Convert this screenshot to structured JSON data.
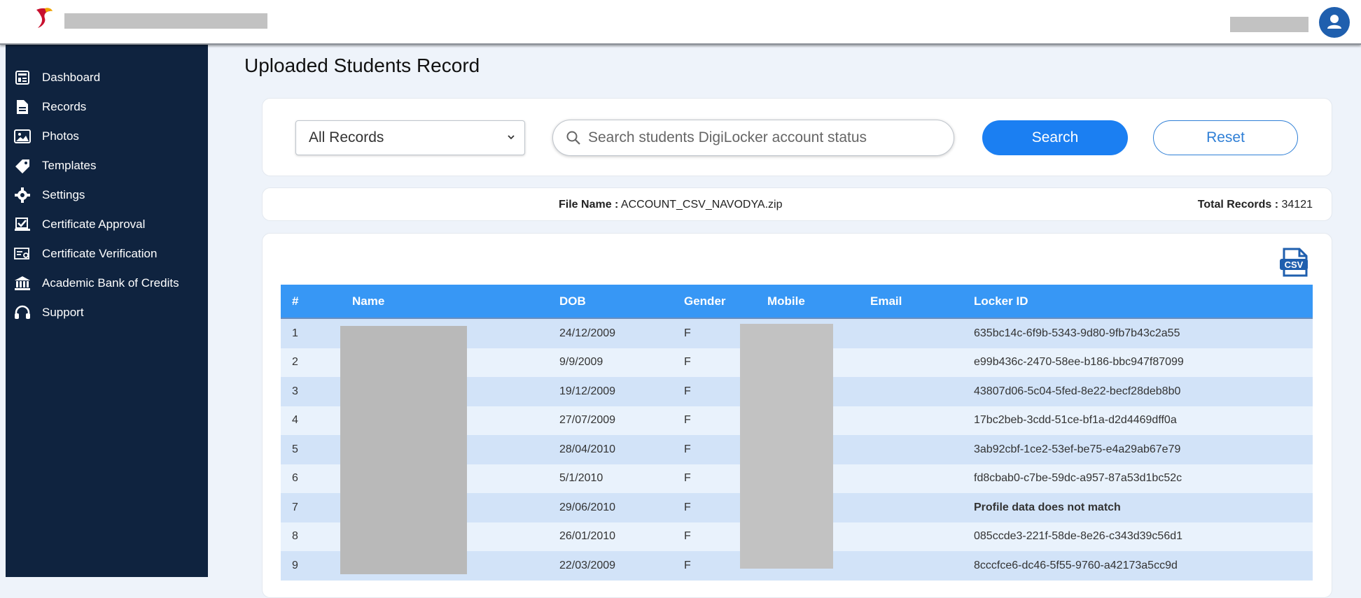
{
  "header": {
    "logo_icon": "logo-icon",
    "avatar_icon": "user-icon",
    "brand_color": "#1f5fae"
  },
  "sidebar": {
    "items": [
      {
        "label": "Dashboard",
        "icon": "dashboard-icon"
      },
      {
        "label": "Records",
        "icon": "file-icon"
      },
      {
        "label": "Photos",
        "icon": "photos-icon"
      },
      {
        "label": "Templates",
        "icon": "tag-icon"
      },
      {
        "label": "Settings",
        "icon": "gear-icon"
      },
      {
        "label": "Certificate Approval",
        "icon": "approval-icon"
      },
      {
        "label": "Certificate Verification",
        "icon": "verification-icon"
      },
      {
        "label": "Academic Bank of Credits",
        "icon": "bank-icon"
      },
      {
        "label": "Support",
        "icon": "headset-icon"
      }
    ]
  },
  "page": {
    "title": "Uploaded Students Record"
  },
  "filter": {
    "select_value": "All Records",
    "search_placeholder": "Search students DigiLocker account status",
    "search_button": "Search",
    "reset_button": "Reset"
  },
  "info": {
    "file_label": "File Name :",
    "file_value": "ACCOUNT_CSV_NAVODYA.zip",
    "total_label": "Total Records :",
    "total_value": "34121"
  },
  "table": {
    "csv_icon": "csv-download-icon",
    "columns": [
      "#",
      "Name",
      "DOB",
      "Gender",
      "Mobile",
      "Email",
      "Locker ID"
    ],
    "rows": [
      {
        "num": "1",
        "dob": "24/12/2009",
        "gender": "F",
        "locker": "635bc14c-6f9b-5343-9d80-9fb7b43c2a55"
      },
      {
        "num": "2",
        "dob": "9/9/2009",
        "gender": "F",
        "locker": "e99b436c-2470-58ee-b186-bbc947f87099"
      },
      {
        "num": "3",
        "dob": "19/12/2009",
        "gender": "F",
        "locker": "43807d06-5c04-5fed-8e22-becf28deb8b0"
      },
      {
        "num": "4",
        "dob": "27/07/2009",
        "gender": "F",
        "locker": "17bc2beb-3cdd-51ce-bf1a-d2d4469dff0a"
      },
      {
        "num": "5",
        "dob": "28/04/2010",
        "gender": "F",
        "locker": "3ab92cbf-1ce2-53ef-be75-e4a29ab67e79"
      },
      {
        "num": "6",
        "dob": "5/1/2010",
        "gender": "F",
        "locker": "fd8cbab0-c7be-59dc-a957-87a53d1bc52c"
      },
      {
        "num": "7",
        "dob": "29/06/2010",
        "gender": "F",
        "locker": "Profile data does not match"
      },
      {
        "num": "8",
        "dob": "26/01/2010",
        "gender": "F",
        "locker": "085ccde3-221f-58de-8e26-c343d39c56d1"
      },
      {
        "num": "9",
        "dob": "22/03/2009",
        "gender": "F",
        "locker": "8cccfce6-dc46-5f55-9760-a42173a5cc9d"
      }
    ]
  },
  "colors": {
    "sidebar_bg": "#0f233f",
    "table_header": "#3797f5",
    "primary_button": "#1b7ff2",
    "error_text": "#ee0000"
  }
}
